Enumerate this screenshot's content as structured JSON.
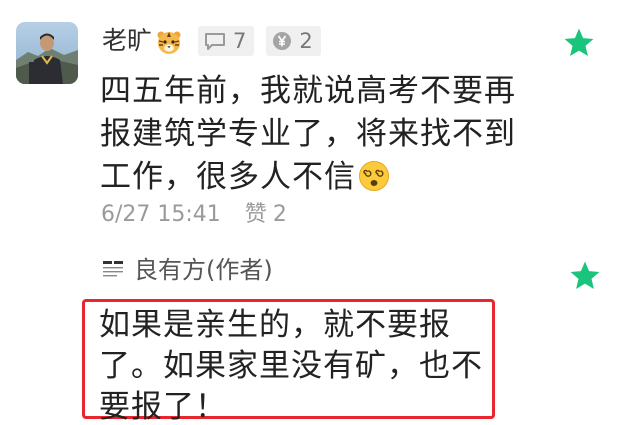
{
  "comment": {
    "author": "老旷",
    "author_icon": "tiger-face-icon",
    "reply_count": "7",
    "reward_count": "2",
    "text": "四五年前，我就说高考不要再报建筑学专业了，将来找不到工作，很多人不信",
    "trailing_emoji": "dizzy-face-emoji",
    "date": "6/27 15:41",
    "like_label": "赞",
    "like_count": "2"
  },
  "reply": {
    "author": "良有方(作者)",
    "text": "如果是亲生的，就不要报了。如果家里没有矿，也不要报了！"
  },
  "colors": {
    "star": "#1bc47d",
    "highlight_border": "#e8262d",
    "meta_text": "#9a9a9a",
    "badge_bg": "#f0f0f0"
  }
}
